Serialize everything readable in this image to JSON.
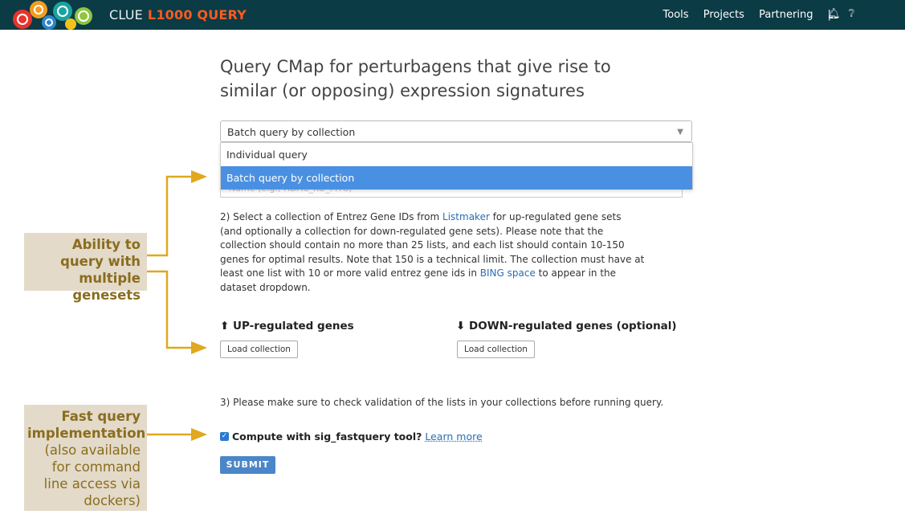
{
  "brand": {
    "prefix": "CLUE",
    "name": "L1000 QUERY"
  },
  "nav": {
    "items": [
      "Tools",
      "Projects",
      "Partnering",
      "|"
    ]
  },
  "icons": {
    "bell": "bell-icon",
    "help": "question-circle-icon"
  },
  "heading": "Query CMap for perturbagens that give rise to similar (or opposing) expression signatures",
  "query_select": {
    "value": "Batch query by collection",
    "options": [
      "Individual query",
      "Batch query by collection"
    ],
    "highlighted": "Batch query by collection"
  },
  "hidden_input": {
    "placeholder": "Name (e.g., HDAC_KO_MYC)"
  },
  "step2": {
    "text1": "2) Select a collection of Entrez Gene IDs from ",
    "link1": "Listmaker",
    "text2": " for up-regulated gene sets (and optionally a collection for down-regulated gene sets). Please note that the collection should contain no more than 25 lists, and each list should contain 10-150 genes for optimal results. Note that 150 is a technical limit. The collection must have at least one list with 10 or more valid entrez gene ids in ",
    "link2": "BING space",
    "text3": " to appear in the dataset dropdown."
  },
  "up": {
    "title": "UP-regulated genes",
    "button": "Load collection"
  },
  "down": {
    "title": "DOWN-regulated genes (optional)",
    "button": "Load collection"
  },
  "step3": "3) Please make sure to check validation of the lists in your collections before running query.",
  "fastquery": {
    "label": "Compute with sig_fastquery tool?",
    "checked": true,
    "learn": "Learn more"
  },
  "submit": "SUBMIT",
  "callouts": {
    "multi": {
      "bold": "Ability to query with multiple genesets"
    },
    "fast": {
      "bold": "Fast query implementation",
      "normal": "(also available for command line access via dockers)"
    }
  },
  "colors": {
    "topbar": "#0b3b45",
    "brand_accent": "#ff5a1f",
    "callout_bg": "#e3dac9",
    "callout_text": "#8a6d1f",
    "arrow": "#e0a81e",
    "selected": "#4a90e2"
  }
}
